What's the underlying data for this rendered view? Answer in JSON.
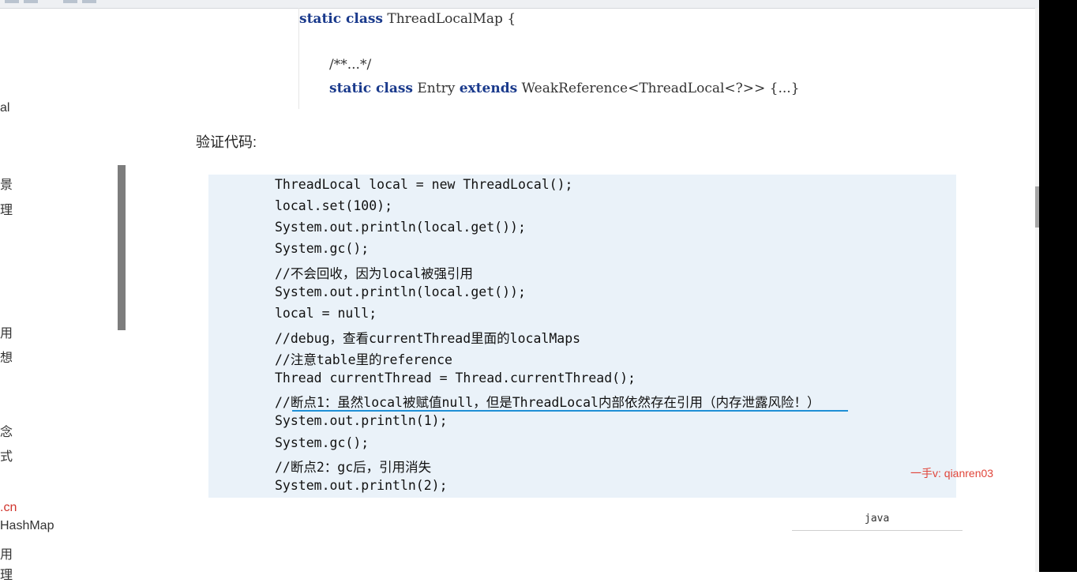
{
  "toolbar": {
    "icons": [
      "bold-icon",
      "italic-icon",
      "image-icon",
      "table-icon"
    ]
  },
  "outline": {
    "items": [
      {
        "label": "al",
        "red": false
      },
      {
        "label": "景",
        "red": false
      },
      {
        "label": "理",
        "red": false
      },
      {
        "label": "用",
        "red": false
      },
      {
        "label": "想",
        "red": false
      },
      {
        "label": "念",
        "red": false
      },
      {
        "label": "式",
        "red": false
      },
      {
        "label": ".cn",
        "red": true
      },
      {
        "label": "HashMap",
        "red": false
      },
      {
        "label": "用",
        "red": false
      },
      {
        "label": "理",
        "red": false
      }
    ]
  },
  "top_code": {
    "line1_kw": "static class",
    "line1_rest": " ThreadLocalMap {",
    "line2": "/**...*/",
    "line3_kw1": "static class",
    "line3_mid": " Entry ",
    "line3_kw2": "extends",
    "line3_rest": " WeakReference<ThreadLocal<?>> {...}"
  },
  "section_heading": "验证代码:",
  "code_lines": [
    "ThreadLocal local = new ThreadLocal();",
    "local.set(100);",
    "System.out.println(local.get());",
    "System.gc();",
    "//不会回收，因为local被强引用",
    "System.out.println(local.get());",
    "local = null;",
    "//debug，查看currentThread里面的localMaps",
    "//注意table里的reference",
    "Thread currentThread = Thread.currentThread();",
    "//断点1：虽然local被赋值null，但是ThreadLocal内部依然存在引用（内存泄露风险！）",
    "System.out.println(1);",
    "System.gc();",
    "//断点2：gc后，引用消失",
    "System.out.println(2);"
  ],
  "code_language": "java",
  "watermark": "一手v: qianren03",
  "colors": {
    "code_bg": "#eaf2f9",
    "keyword": "#1a3a8c",
    "underline": "#1f8fd6",
    "watermark": "#e0453a"
  }
}
